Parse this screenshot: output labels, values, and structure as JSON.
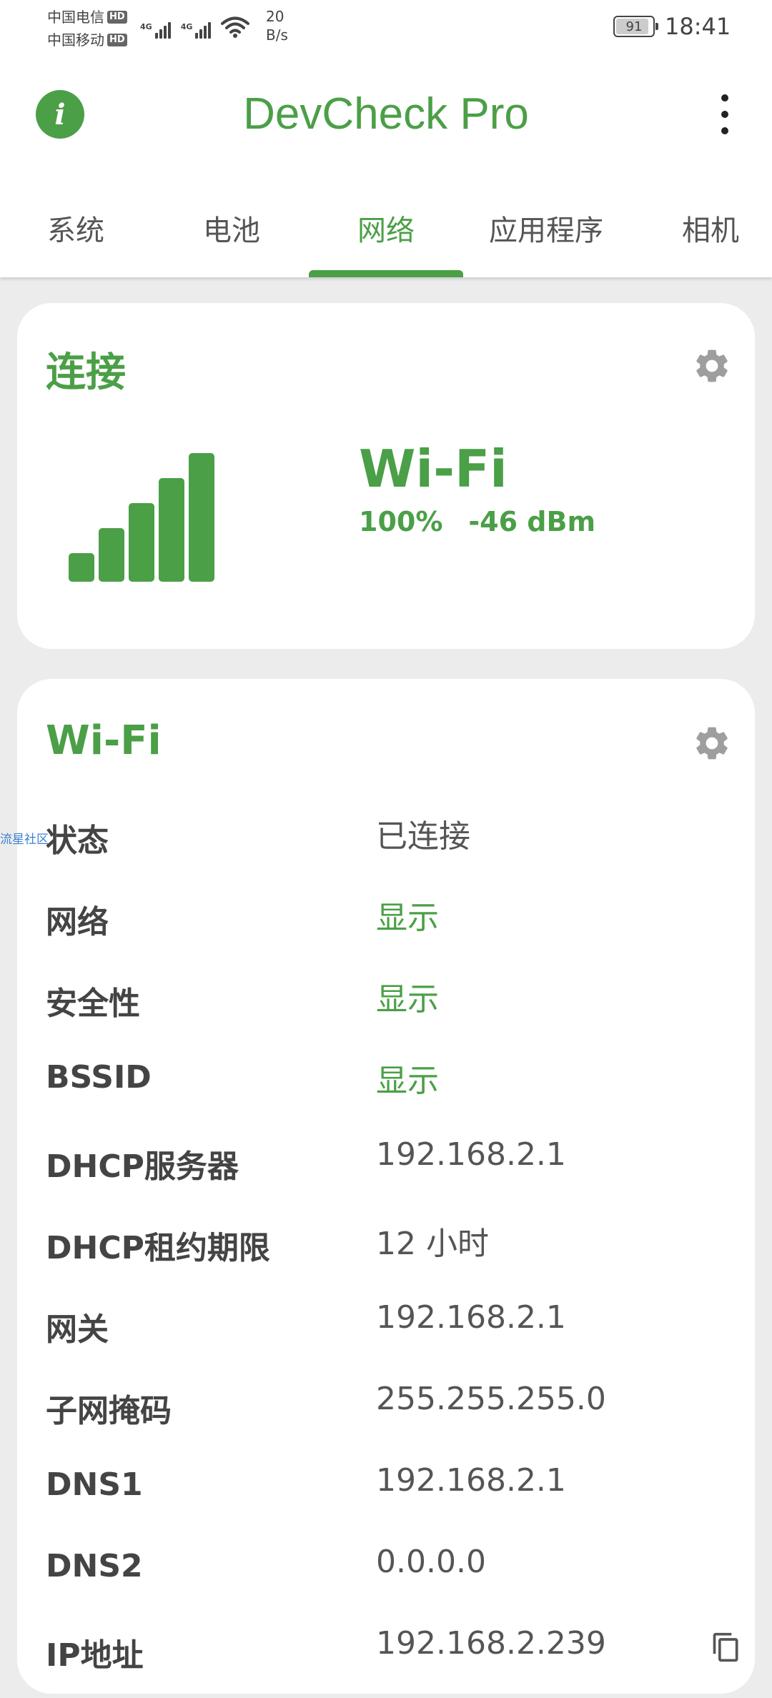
{
  "status_bar": {
    "carrier1": "中国电信",
    "carrier2": "中国移动",
    "hd_badge": "HD",
    "net_label": "4G",
    "net_speed_value": "20",
    "net_speed_unit": "B/s",
    "battery_level": "91",
    "time": "18:41"
  },
  "app_bar": {
    "info_glyph": "i",
    "title": "DevCheck Pro"
  },
  "tabs": [
    {
      "label": "系统"
    },
    {
      "label": "电池"
    },
    {
      "label": "网络",
      "active": true
    },
    {
      "label": "应用程序"
    },
    {
      "label": "相机"
    }
  ],
  "connection_card": {
    "title": "连接",
    "type": "Wi-Fi",
    "signal_percent": "100%",
    "signal_dbm": "-46 dBm",
    "signal_level_fraction": 1.0
  },
  "wifi_card": {
    "title": "Wi-Fi",
    "rows": [
      {
        "label": "状态",
        "value": "已连接",
        "link": false
      },
      {
        "label": "网络",
        "value": "显示",
        "link": true
      },
      {
        "label": "安全性",
        "value": "显示",
        "link": true
      },
      {
        "label": "BSSID",
        "value": "显示",
        "link": true
      },
      {
        "label": "DHCP服务器",
        "value": "192.168.2.1",
        "link": false
      },
      {
        "label": "DHCP租约期限",
        "value": "12 小时",
        "link": false
      },
      {
        "label": "网关",
        "value": "192.168.2.1",
        "link": false
      },
      {
        "label": "子网掩码",
        "value": "255.255.255.0",
        "link": false
      },
      {
        "label": "DNS1",
        "value": "192.168.2.1",
        "link": false
      },
      {
        "label": "DNS2",
        "value": "0.0.0.0",
        "link": false
      },
      {
        "label": "IP地址",
        "value": "192.168.2.239",
        "link": false
      }
    ]
  },
  "watermark": "流星社区",
  "colors": {
    "accent": "#4b9f47",
    "background": "#ececec",
    "card": "#ffffff",
    "label": "#444444",
    "value": "#555555"
  },
  "icons": [
    "info-icon",
    "more-vert-icon",
    "gear-icon",
    "copy-icon",
    "wifi-icon",
    "signal-icon",
    "battery-icon"
  ]
}
